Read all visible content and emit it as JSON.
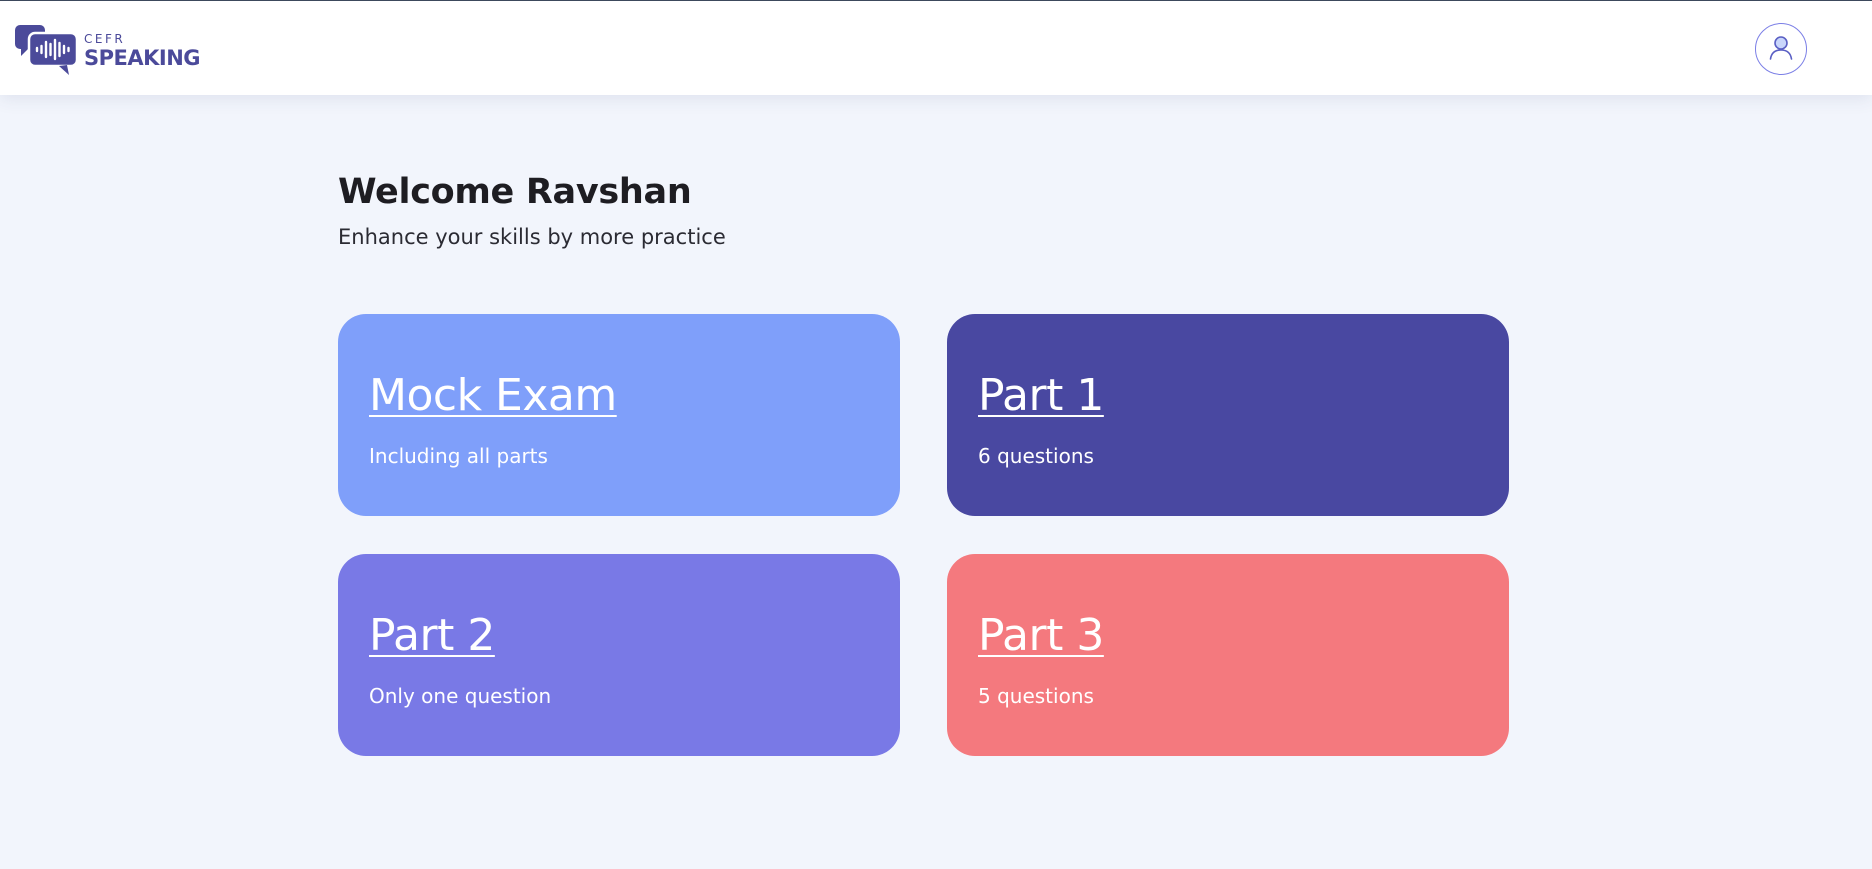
{
  "header": {
    "logo": {
      "small_text": "CEFR",
      "big_text": "SPEAKING",
      "icon": "speech-bubble-waveform-icon",
      "color": "#4b4a9a"
    },
    "avatar_icon": "user-icon"
  },
  "main": {
    "welcome": "Welcome Ravshan",
    "subtitle": "Enhance your skills by more practice",
    "cards": [
      {
        "title": "Mock Exam",
        "subtitle": "Including all parts",
        "color": "#7f9ffa"
      },
      {
        "title": "Part 1",
        "subtitle": "6 questions",
        "color": "#4948a1"
      },
      {
        "title": "Part 2",
        "subtitle": "Only one question",
        "color": "#7979e6"
      },
      {
        "title": "Part 3",
        "subtitle": "5 questions",
        "color": "#f4797e"
      }
    ]
  },
  "colors": {
    "page_background": "#f2f5fc",
    "header_background": "#ffffff",
    "avatar_accent": "#7b7fe6"
  }
}
